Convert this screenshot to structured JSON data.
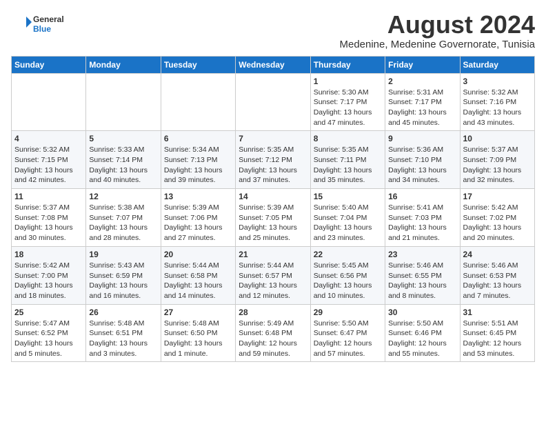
{
  "header": {
    "logo_line1": "General",
    "logo_line2": "Blue",
    "month_year": "August 2024",
    "location": "Medenine, Medenine Governorate, Tunisia"
  },
  "days_of_week": [
    "Sunday",
    "Monday",
    "Tuesday",
    "Wednesday",
    "Thursday",
    "Friday",
    "Saturday"
  ],
  "weeks": [
    [
      {
        "day": "",
        "text": ""
      },
      {
        "day": "",
        "text": ""
      },
      {
        "day": "",
        "text": ""
      },
      {
        "day": "",
        "text": ""
      },
      {
        "day": "1",
        "text": "Sunrise: 5:30 AM\nSunset: 7:17 PM\nDaylight: 13 hours\nand 47 minutes."
      },
      {
        "day": "2",
        "text": "Sunrise: 5:31 AM\nSunset: 7:17 PM\nDaylight: 13 hours\nand 45 minutes."
      },
      {
        "day": "3",
        "text": "Sunrise: 5:32 AM\nSunset: 7:16 PM\nDaylight: 13 hours\nand 43 minutes."
      }
    ],
    [
      {
        "day": "4",
        "text": "Sunrise: 5:32 AM\nSunset: 7:15 PM\nDaylight: 13 hours\nand 42 minutes."
      },
      {
        "day": "5",
        "text": "Sunrise: 5:33 AM\nSunset: 7:14 PM\nDaylight: 13 hours\nand 40 minutes."
      },
      {
        "day": "6",
        "text": "Sunrise: 5:34 AM\nSunset: 7:13 PM\nDaylight: 13 hours\nand 39 minutes."
      },
      {
        "day": "7",
        "text": "Sunrise: 5:35 AM\nSunset: 7:12 PM\nDaylight: 13 hours\nand 37 minutes."
      },
      {
        "day": "8",
        "text": "Sunrise: 5:35 AM\nSunset: 7:11 PM\nDaylight: 13 hours\nand 35 minutes."
      },
      {
        "day": "9",
        "text": "Sunrise: 5:36 AM\nSunset: 7:10 PM\nDaylight: 13 hours\nand 34 minutes."
      },
      {
        "day": "10",
        "text": "Sunrise: 5:37 AM\nSunset: 7:09 PM\nDaylight: 13 hours\nand 32 minutes."
      }
    ],
    [
      {
        "day": "11",
        "text": "Sunrise: 5:37 AM\nSunset: 7:08 PM\nDaylight: 13 hours\nand 30 minutes."
      },
      {
        "day": "12",
        "text": "Sunrise: 5:38 AM\nSunset: 7:07 PM\nDaylight: 13 hours\nand 28 minutes."
      },
      {
        "day": "13",
        "text": "Sunrise: 5:39 AM\nSunset: 7:06 PM\nDaylight: 13 hours\nand 27 minutes."
      },
      {
        "day": "14",
        "text": "Sunrise: 5:39 AM\nSunset: 7:05 PM\nDaylight: 13 hours\nand 25 minutes."
      },
      {
        "day": "15",
        "text": "Sunrise: 5:40 AM\nSunset: 7:04 PM\nDaylight: 13 hours\nand 23 minutes."
      },
      {
        "day": "16",
        "text": "Sunrise: 5:41 AM\nSunset: 7:03 PM\nDaylight: 13 hours\nand 21 minutes."
      },
      {
        "day": "17",
        "text": "Sunrise: 5:42 AM\nSunset: 7:02 PM\nDaylight: 13 hours\nand 20 minutes."
      }
    ],
    [
      {
        "day": "18",
        "text": "Sunrise: 5:42 AM\nSunset: 7:00 PM\nDaylight: 13 hours\nand 18 minutes."
      },
      {
        "day": "19",
        "text": "Sunrise: 5:43 AM\nSunset: 6:59 PM\nDaylight: 13 hours\nand 16 minutes."
      },
      {
        "day": "20",
        "text": "Sunrise: 5:44 AM\nSunset: 6:58 PM\nDaylight: 13 hours\nand 14 minutes."
      },
      {
        "day": "21",
        "text": "Sunrise: 5:44 AM\nSunset: 6:57 PM\nDaylight: 13 hours\nand 12 minutes."
      },
      {
        "day": "22",
        "text": "Sunrise: 5:45 AM\nSunset: 6:56 PM\nDaylight: 13 hours\nand 10 minutes."
      },
      {
        "day": "23",
        "text": "Sunrise: 5:46 AM\nSunset: 6:55 PM\nDaylight: 13 hours\nand 8 minutes."
      },
      {
        "day": "24",
        "text": "Sunrise: 5:46 AM\nSunset: 6:53 PM\nDaylight: 13 hours\nand 7 minutes."
      }
    ],
    [
      {
        "day": "25",
        "text": "Sunrise: 5:47 AM\nSunset: 6:52 PM\nDaylight: 13 hours\nand 5 minutes."
      },
      {
        "day": "26",
        "text": "Sunrise: 5:48 AM\nSunset: 6:51 PM\nDaylight: 13 hours\nand 3 minutes."
      },
      {
        "day": "27",
        "text": "Sunrise: 5:48 AM\nSunset: 6:50 PM\nDaylight: 13 hours\nand 1 minute."
      },
      {
        "day": "28",
        "text": "Sunrise: 5:49 AM\nSunset: 6:48 PM\nDaylight: 12 hours\nand 59 minutes."
      },
      {
        "day": "29",
        "text": "Sunrise: 5:50 AM\nSunset: 6:47 PM\nDaylight: 12 hours\nand 57 minutes."
      },
      {
        "day": "30",
        "text": "Sunrise: 5:50 AM\nSunset: 6:46 PM\nDaylight: 12 hours\nand 55 minutes."
      },
      {
        "day": "31",
        "text": "Sunrise: 5:51 AM\nSunset: 6:45 PM\nDaylight: 12 hours\nand 53 minutes."
      }
    ]
  ]
}
